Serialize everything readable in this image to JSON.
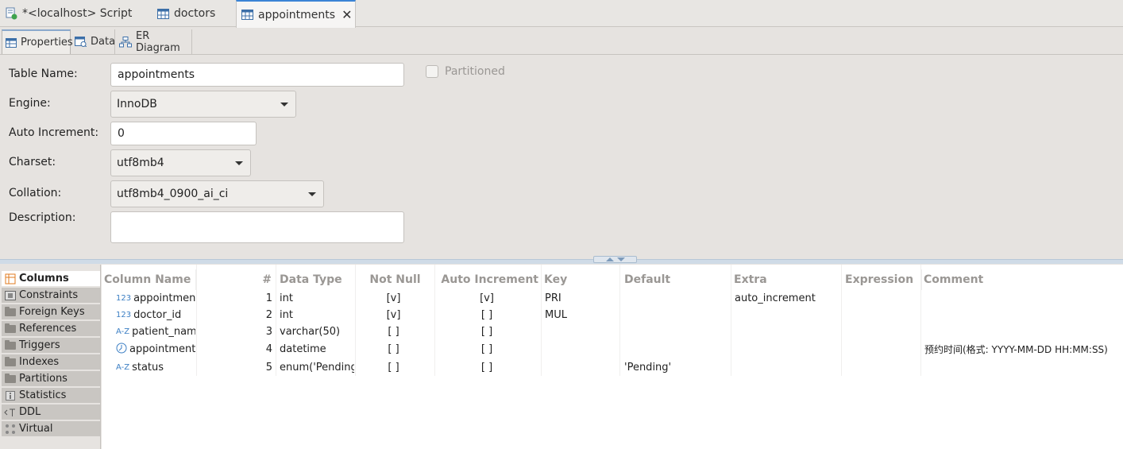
{
  "editor_tabs": [
    {
      "label": "*<localhost> Script"
    },
    {
      "label": "doctors"
    },
    {
      "label": "appointments"
    }
  ],
  "sub_tabs": [
    {
      "label": "Properties"
    },
    {
      "label": "Data"
    },
    {
      "label": "ER Diagram"
    }
  ],
  "form": {
    "table_name_label": "Table Name:",
    "table_name_value": "appointments",
    "engine_label": "Engine:",
    "engine_value": "InnoDB",
    "auto_increment_label": "Auto Increment:",
    "auto_increment_value": "0",
    "charset_label": "Charset:",
    "charset_value": "utf8mb4",
    "collation_label": "Collation:",
    "collation_value": "utf8mb4_0900_ai_ci",
    "description_label": "Description:",
    "partitioned_label": "Partitioned"
  },
  "nav": [
    {
      "label": "Columns"
    },
    {
      "label": "Constraints"
    },
    {
      "label": "Foreign Keys"
    },
    {
      "label": "References"
    },
    {
      "label": "Triggers"
    },
    {
      "label": "Indexes"
    },
    {
      "label": "Partitions"
    },
    {
      "label": "Statistics"
    },
    {
      "label": "DDL"
    },
    {
      "label": "Virtual"
    }
  ],
  "columns_header": [
    "Column Name",
    "#",
    "Data Type",
    "Not Null",
    "Auto Increment",
    "Key",
    "Default",
    "Extra",
    "Expression",
    "Comment"
  ],
  "rows": [
    {
      "icon": "123",
      "name": "appointment_",
      "num": "1",
      "type": "int",
      "not_null": "[v]",
      "auto_inc": "[v]",
      "key": "PRI",
      "default": "",
      "extra": "auto_increment",
      "expression": "",
      "comment": ""
    },
    {
      "icon": "123",
      "name": "doctor_id",
      "num": "2",
      "type": "int",
      "not_null": "[v]",
      "auto_inc": "[ ]",
      "key": "MUL",
      "default": "",
      "extra": "",
      "expression": "",
      "comment": ""
    },
    {
      "icon": "A-Z",
      "name": "patient_name",
      "num": "3",
      "type": "varchar(50)",
      "not_null": "[ ]",
      "auto_inc": "[ ]",
      "key": "",
      "default": "",
      "extra": "",
      "expression": "",
      "comment": ""
    },
    {
      "icon": "clock",
      "name": "appointment_",
      "num": "4",
      "type": "datetime",
      "not_null": "[ ]",
      "auto_inc": "[ ]",
      "key": "",
      "default": "",
      "extra": "",
      "expression": "",
      "comment": "预约时间(格式: YYYY-MM-DD HH:MM:SS)"
    },
    {
      "icon": "A-Z",
      "name": "status",
      "num": "5",
      "type": "enum('Pending",
      "not_null": "[ ]",
      "auto_inc": "[ ]",
      "key": "",
      "default": "'Pending'",
      "extra": "",
      "expression": "",
      "comment": ""
    }
  ]
}
